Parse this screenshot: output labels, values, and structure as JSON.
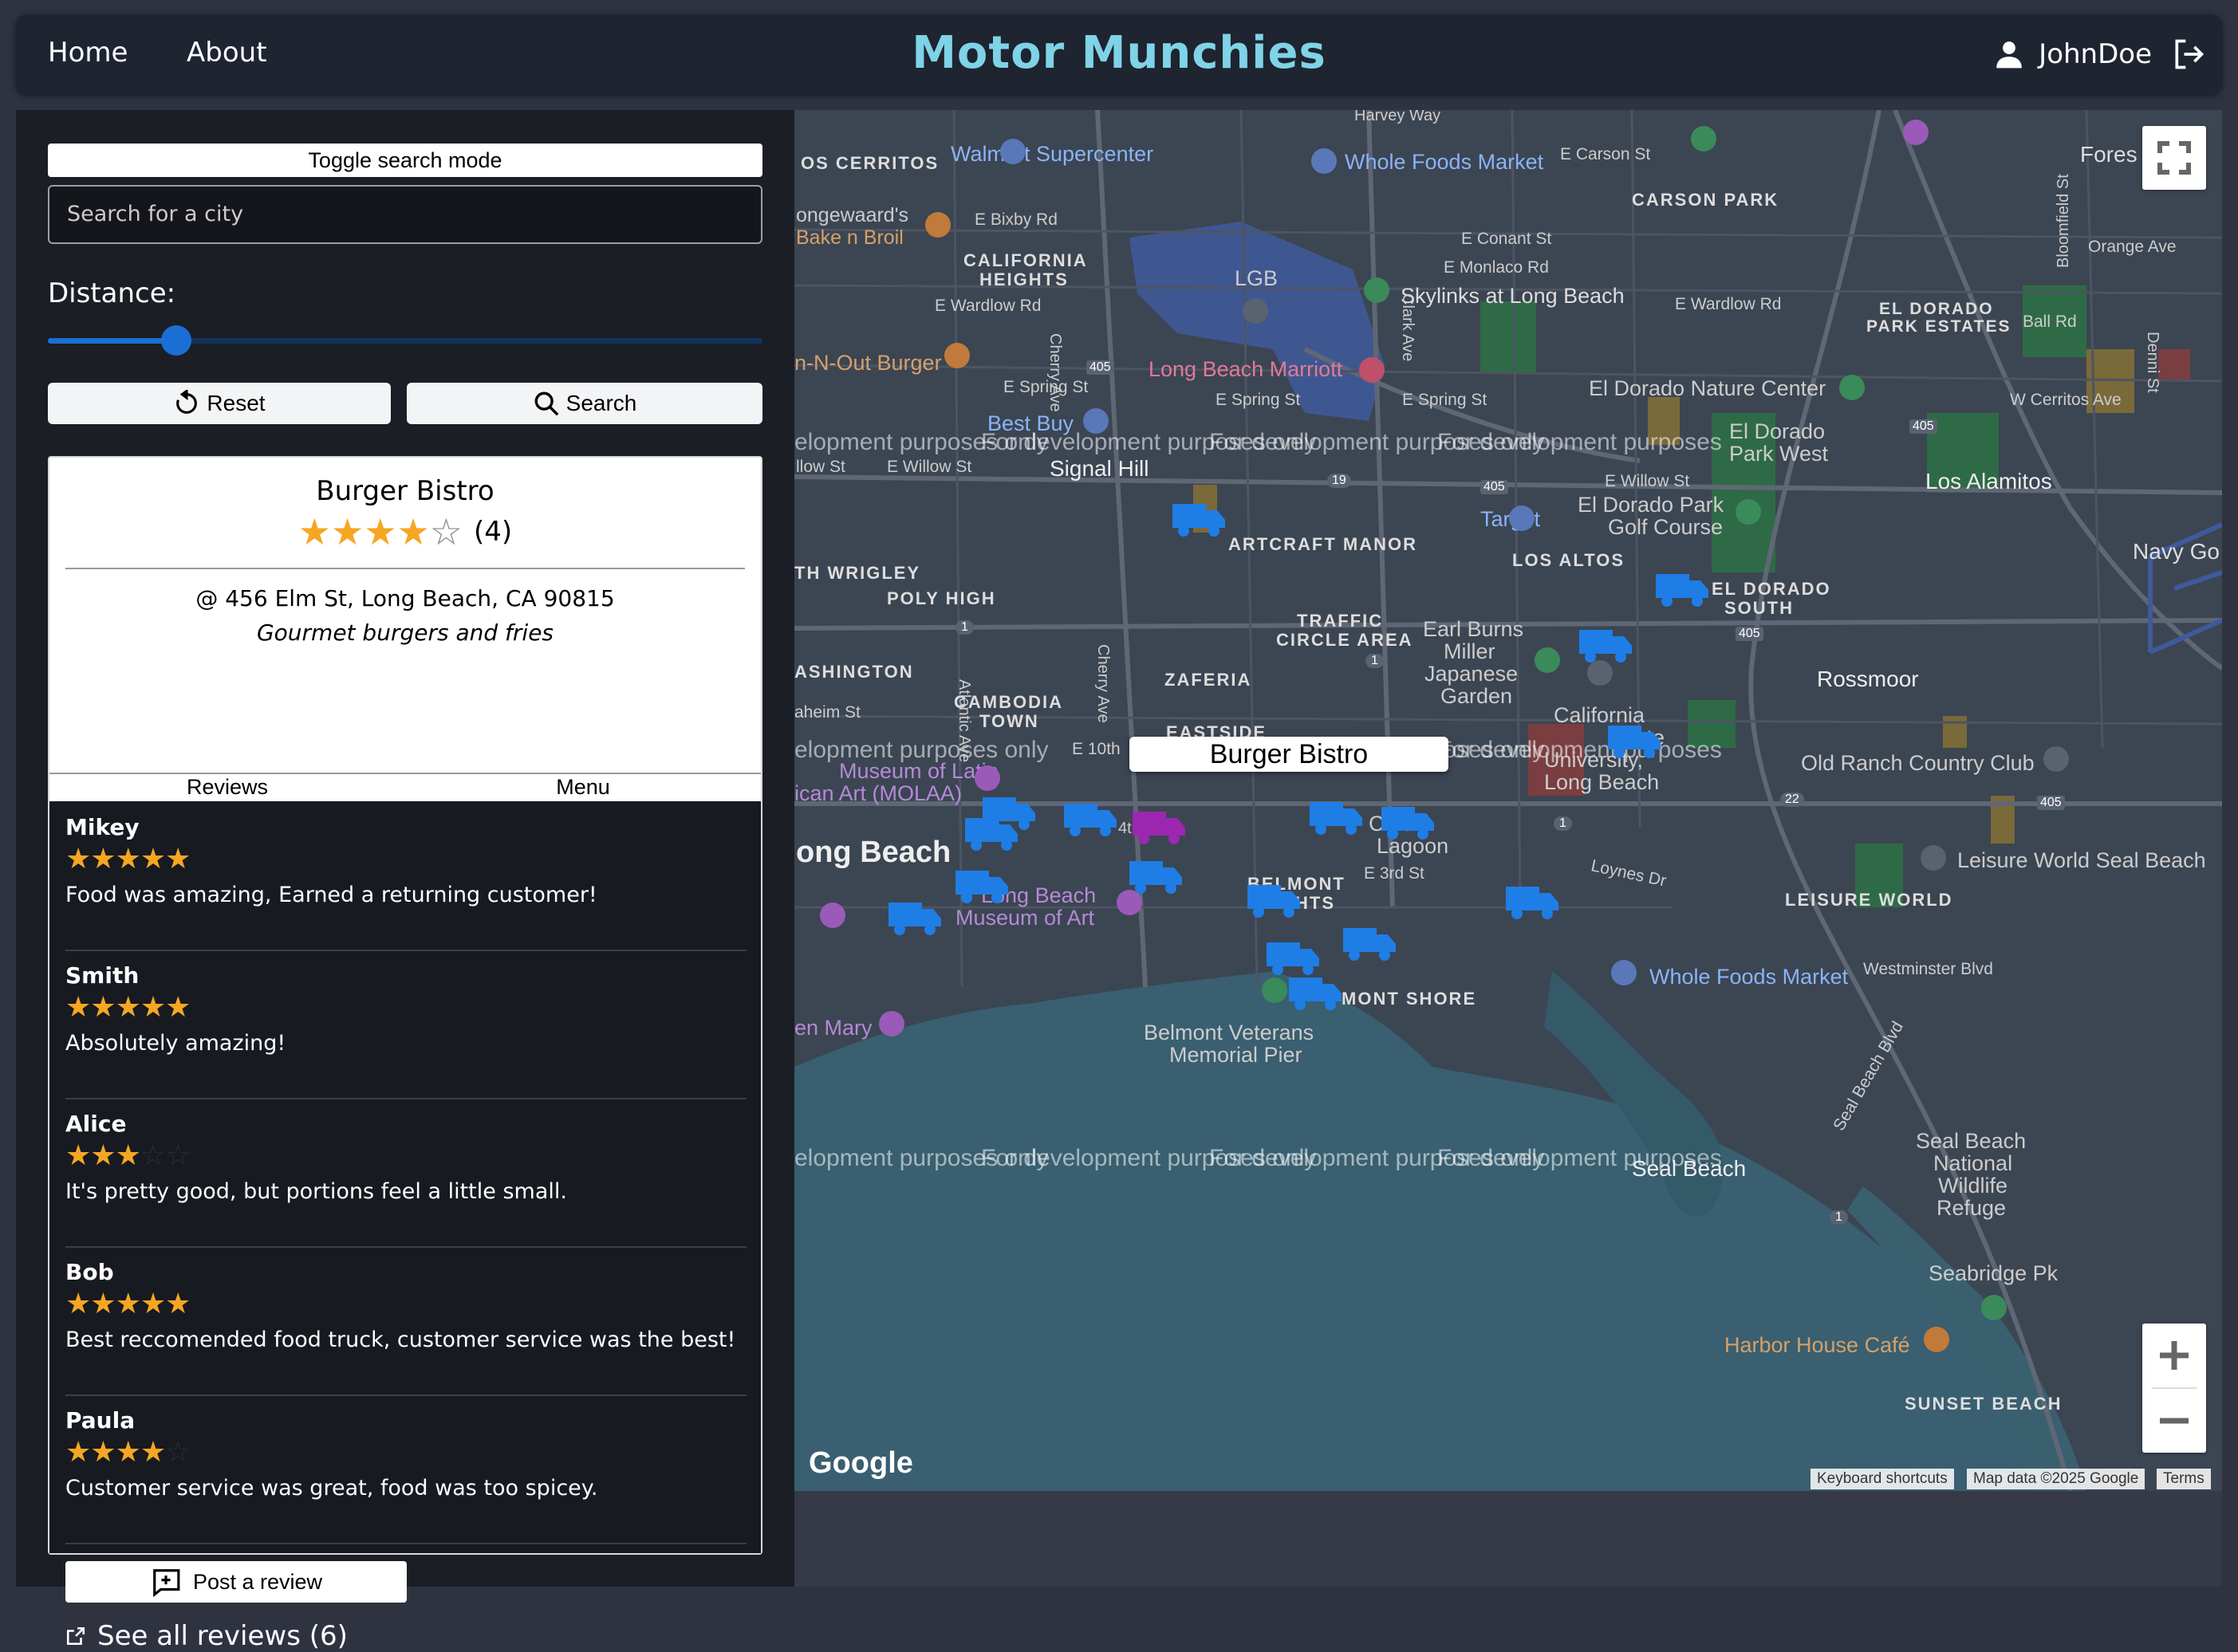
{
  "nav": {
    "home": "Home",
    "about": "About",
    "brand": "Motor Munchies",
    "username": "JohnDoe"
  },
  "sidebar": {
    "toggle_label": "Toggle search mode",
    "search_placeholder": "Search for a city",
    "distance_label": "Distance:",
    "distance_value_fraction": 0.18,
    "reset_label": "Reset",
    "search_label": "Search"
  },
  "card": {
    "name": "Burger Bistro",
    "rating": 4,
    "rating_count": "(4)",
    "address": "@ 456 Elm St, Long Beach, CA 90815",
    "description": "Gourmet burgers and fries",
    "tabs": [
      "Reviews",
      "Menu"
    ],
    "reviews": [
      {
        "author": "Mikey",
        "rating": 5,
        "text": "Food was amazing, Earned a returning customer!"
      },
      {
        "author": "Smith",
        "rating": 5,
        "text": "Absolutely amazing!"
      },
      {
        "author": "Alice",
        "rating": 3,
        "text": "It's pretty good, but portions feel a little small."
      },
      {
        "author": "Bob",
        "rating": 5,
        "text": "Best reccomended food truck, customer service was the best!"
      },
      {
        "author": "Paula",
        "rating": 4,
        "text": "Customer service was great, food was too spicey."
      }
    ],
    "post_review_label": "Post a review",
    "see_all_label": "See all reviews (6)"
  },
  "map": {
    "popup_label": "Burger Bistro",
    "dev_watermark": "For development purposes only",
    "watermark_prefix": "elopment purposes only",
    "watermark_suffix": "For development purposes",
    "google": "Google",
    "attribution": [
      "Keyboard shortcuts",
      "Map data ©2025 Google",
      "Terms"
    ],
    "places": {
      "cerritos": "OS CERRITOS",
      "walmart": "Walmart Supercenter",
      "wholefoods1": "Whole Foods Market",
      "carson_st": "E Carson St",
      "carson_park": "CARSON PARK",
      "forest": "Fores",
      "longewaards": "ongewaard's",
      "bake_n_broil": "Bake n Broil",
      "bixby": "E Bixby Rd",
      "cal_heights1": "CALIFORNIA",
      "cal_heights2": "HEIGHTS",
      "wardlow": "E Wardlow Rd",
      "lgb": "LGB",
      "conant": "E Conant St",
      "monlaco": "E Monlaco Rd",
      "skylinks": "Skylinks at Long Beach",
      "wardlow2": "E Wardlow Rd",
      "el_dorado_pe1": "EL DORADO",
      "el_dorado_pe2": "PARK ESTATES",
      "orange_ave": "Orange Ave",
      "ball_rd": "Ball Rd",
      "innout": "n-N-Out Burger",
      "marriott": "Long Beach Marriott",
      "spring1": "E Spring St",
      "spring2": "E Spring St",
      "spring3": "E Spring St",
      "el_dorado_nc": "El Dorado Nature Center",
      "w_cerritos": "W Cerritos Ave",
      "best_buy": "Best Buy",
      "edpw1": "El Dorado",
      "edpw2": "Park West",
      "willow1": "llow St",
      "willow2": "E Willow St",
      "signal_hill": "Signal Hill",
      "willow3": "E Willow St",
      "edpgc1": "El Dorado Park",
      "edpgc2": "Golf Course",
      "los_alamitos": "Los Alamitos",
      "target": "Target",
      "artcraft": "ARTCRAFT MANOR",
      "los_altos": "LOS ALTOS",
      "navy": "Navy Go",
      "wrigley": "TH WRIGLEY",
      "poly_high": "POLY HIGH",
      "traffic1": "TRAFFIC",
      "traffic2": "CIRCLE AREA",
      "earl1": "Earl Burns",
      "earl2": "Miller",
      "earl3": "Japanese",
      "earl4": "Garden",
      "el_dorado_s1": "EL DORADO",
      "el_dorado_s2": "SOUTH",
      "rossmoor": "Rossmoor",
      "washington": "ASHINGTON",
      "cambodia1": "CAMBODIA",
      "cambodia2": "TOWN",
      "zaferia": "ZAFERIA",
      "anaheim": "aheim St",
      "eastside": "EASTSIDE",
      "e10th": "E 10th",
      "csulb1": "California",
      "csulb2": "State",
      "csulb3": "University,",
      "csulb4": "Long Beach",
      "old_ranch": "Old Ranch Country Club",
      "molaa1": "Museum of Latin",
      "molaa2": "ican Art (MOLAA)",
      "long_beach": "ong Beach",
      "colorado1": "Co     do",
      "colorado2": "Lagoon",
      "e3rd": "E 3rd St",
      "belmont1": "BELMONT",
      "belmont2": "HTS",
      "loynes": "Loynes Dr",
      "leisure_sb": "Leisure World Seal Beach",
      "lbma1": "Long Beach",
      "lbma2": "Museum of Art",
      "leisure": "LEISURE WORLD",
      "wholefoods2": "Whole Foods Market",
      "westminster": "Westminster Blvd",
      "mary": "en Mary",
      "belmont_shore": "MONT SHORE",
      "pier1": "Belmont Veterans",
      "pier2": "Memorial Pier",
      "seal_beach_blvd": "Seal Beach Blvd",
      "seal_beach": "Seal Beach",
      "swr1": "Seal Beach",
      "swr2": "National",
      "swr3": "Wildlife",
      "swr4": "Refuge",
      "seabridge": "Seabridge Pk",
      "harbor_house": "Harbor House Café",
      "sunset_beach": "SUNSET BEACH",
      "cherry1": "Cherry Ave",
      "cherry2": "Cherry Ave",
      "clark": "Clark Ave",
      "atlantic": "Atlantic Ave",
      "harvey": "Harvey Way",
      "bloomfield": "Bloomfield St",
      "denni": "Denni St",
      "fourth": "4th"
    },
    "shields": [
      "405",
      "405",
      "405",
      "405",
      "19",
      "1",
      "1",
      "1",
      "22",
      "405",
      "1"
    ]
  },
  "colors": {
    "brand": "#7fd3e6",
    "accent": "#1b6fd4",
    "star": "#f5a623",
    "truck": "#1e7ee6",
    "selected_truck": "#9c27b0"
  },
  "icons": [
    "reset-icon",
    "search-icon",
    "user-icon",
    "logout-icon",
    "post-review-icon",
    "external-link-icon",
    "truck-icon",
    "fullscreen-icon",
    "zoom-in-icon",
    "zoom-out-icon"
  ]
}
